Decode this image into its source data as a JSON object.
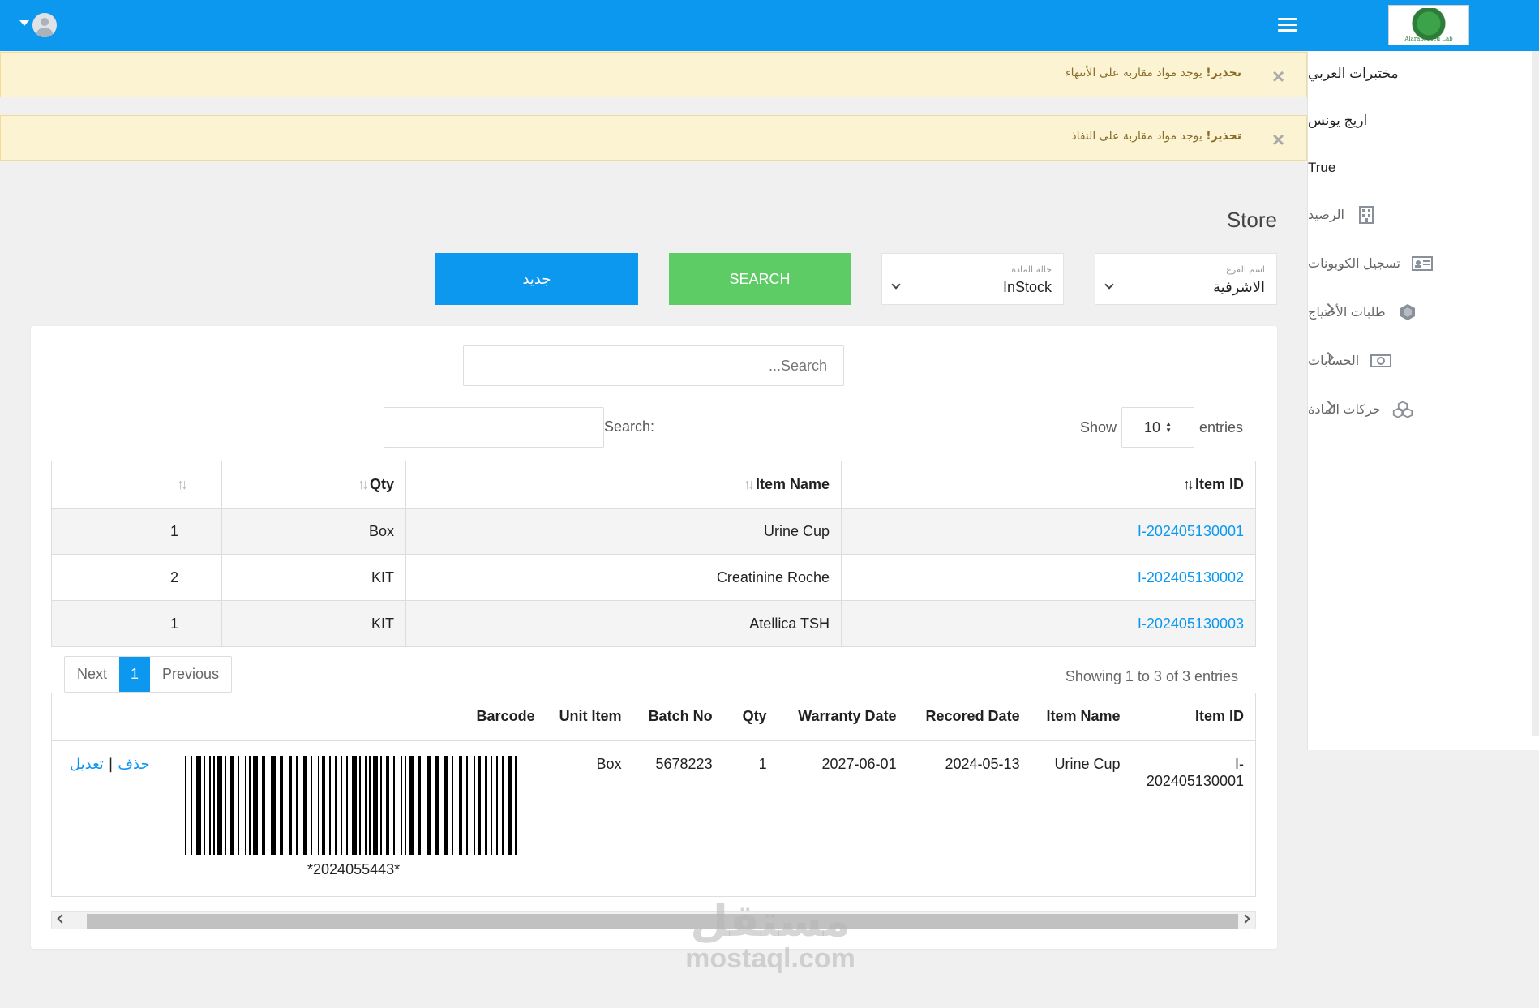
{
  "header": {
    "logo_text": "Alarabi Med Lab"
  },
  "sidebar": {
    "lab_name": "مختبرات العربي",
    "user_name": "اريج يونس",
    "flag": "True",
    "items": [
      {
        "label": "الرصيد",
        "icon": "building-icon",
        "expandable": false
      },
      {
        "label": "تسجيل الكوبونات",
        "icon": "id-card-icon",
        "expandable": false
      },
      {
        "label": "طلبات الأحتياج",
        "icon": "cube-icon",
        "expandable": true
      },
      {
        "label": "الحسابات",
        "icon": "money-icon",
        "expandable": true
      },
      {
        "label": "حركات المادة",
        "icon": "cubes-icon",
        "expandable": true
      }
    ]
  },
  "alerts": [
    {
      "strong": "تحذير!",
      "message": " يوجد مواد مقاربة على الأنتهاء"
    },
    {
      "strong": "تحذير!",
      "message": " يوجد مواد مقاربة على النفاذ"
    }
  ],
  "page": {
    "title": "Store"
  },
  "filters": {
    "branch_label": "اسم الفرع",
    "branch_value": "الاشرفية",
    "status_label": "حالة المادة",
    "status_value": "InStock",
    "search_button": "SEARCH",
    "new_button": "جديد"
  },
  "panel": {
    "top_search_placeholder": "Search...",
    "show_label": "Show",
    "entries_value": "10",
    "entries_label": "entries",
    "filter_label": "Search:",
    "info": "Showing 1 to 3 of 3 entries",
    "pager": {
      "prev": "Previous",
      "current": "1",
      "next": "Next"
    }
  },
  "table1": {
    "headers": {
      "item_id": "Item ID",
      "item_name": "Item Name",
      "qty": "Qty"
    },
    "rows": [
      {
        "item_id": "I-202405130001",
        "item_name": "Urine Cup",
        "unit": "Box",
        "qty": "1"
      },
      {
        "item_id": "I-202405130002",
        "item_name": "Creatinine Roche",
        "unit": "KIT",
        "qty": "2"
      },
      {
        "item_id": "I-202405130003",
        "item_name": "Atellica TSH",
        "unit": "KIT",
        "qty": "1"
      }
    ]
  },
  "table2": {
    "headers": {
      "item_id": "Item ID",
      "item_name": "Item Name",
      "recorded_date": "Recored Date",
      "warranty_date": "Warranty Date",
      "qty": "Qty",
      "batch_no": "Batch No",
      "unit_item": "Unit Item",
      "barcode": "Barcode"
    },
    "row": {
      "item_id": "I-202405130001",
      "item_name": "Urine Cup",
      "recorded_date": "2024-05-13",
      "warranty_date": "2027-06-01",
      "qty": "1",
      "batch_no": "5678223",
      "unit_item": "Box",
      "barcode_text": "*2024055443*",
      "edit": "تعديل",
      "separator": "|",
      "delete": "حذف"
    }
  },
  "watermark": {
    "arabic": "مستقل",
    "latin": "mostaql.com"
  },
  "colors": {
    "primary": "#0c98ef",
    "success": "#5dcc64",
    "warning_bg": "#fcf3d3"
  }
}
